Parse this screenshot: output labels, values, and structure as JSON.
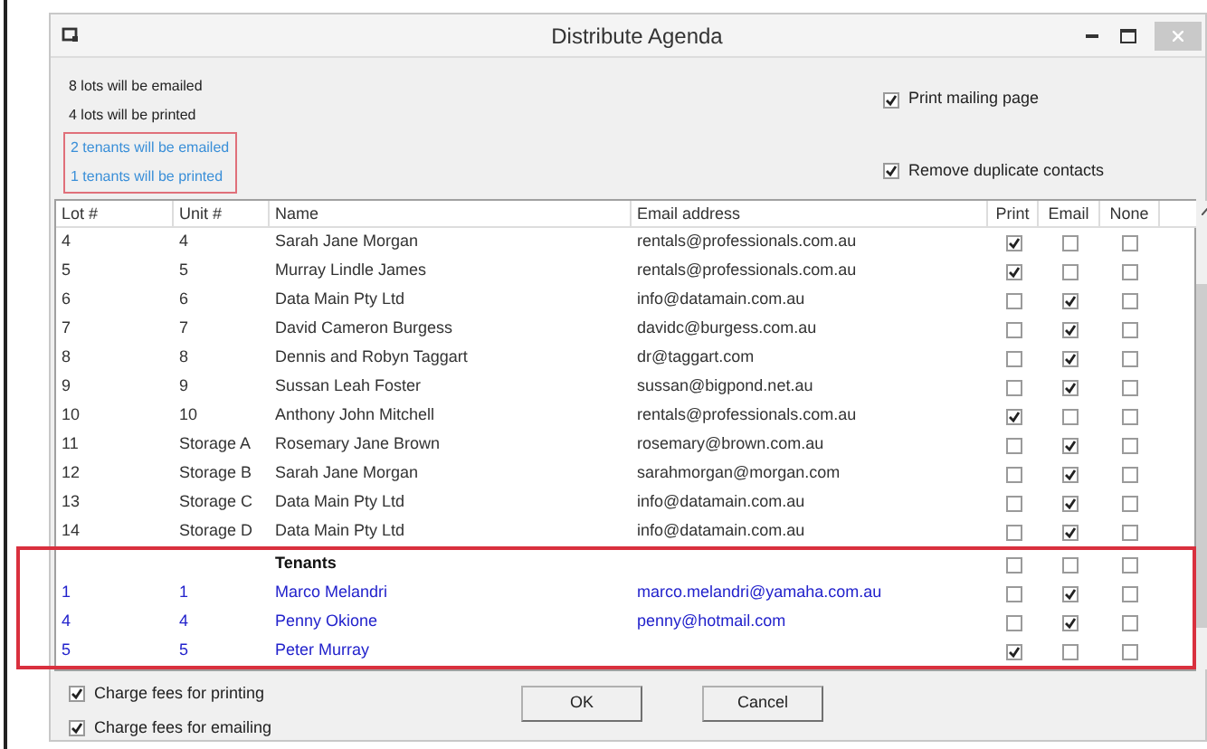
{
  "window": {
    "title": "Distribute Agenda"
  },
  "summary": [
    {
      "text": "8 lots will be emailed",
      "kind": "owner"
    },
    {
      "text": "4 lots will be printed",
      "kind": "owner"
    },
    {
      "text": "2 tenants will be emailed",
      "kind": "tenant"
    },
    {
      "text": "1 tenants will be printed",
      "kind": "tenant"
    }
  ],
  "options": [
    {
      "label": "Print mailing page",
      "checked": true
    },
    {
      "label": "Remove duplicate contacts",
      "checked": true
    }
  ],
  "table": {
    "columns": [
      "Lot #",
      "Unit #",
      "Name",
      "Email address",
      "Print",
      "Email",
      "None"
    ],
    "rows": [
      {
        "lot": "4",
        "unit": "4",
        "name": "Sarah Jane Morgan",
        "email": "rentals@professionals.com.au",
        "print": true,
        "mail": false,
        "none": false
      },
      {
        "lot": "5",
        "unit": "5",
        "name": "Murray Lindle James",
        "email": "rentals@professionals.com.au",
        "print": true,
        "mail": false,
        "none": false
      },
      {
        "lot": "6",
        "unit": "6",
        "name": "Data Main Pty Ltd",
        "email": "info@datamain.com.au",
        "print": false,
        "mail": true,
        "none": false
      },
      {
        "lot": "7",
        "unit": "7",
        "name": "David Cameron Burgess",
        "email": "davidc@burgess.com.au",
        "print": false,
        "mail": true,
        "none": false
      },
      {
        "lot": "8",
        "unit": "8",
        "name": "Dennis and Robyn Taggart",
        "email": "dr@taggart.com",
        "print": false,
        "mail": true,
        "none": false
      },
      {
        "lot": "9",
        "unit": "9",
        "name": "Sussan Leah Foster",
        "email": "sussan@bigpond.net.au",
        "print": false,
        "mail": true,
        "none": false
      },
      {
        "lot": "10",
        "unit": "10",
        "name": "Anthony John Mitchell",
        "email": "rentals@professionals.com.au",
        "print": true,
        "mail": false,
        "none": false
      },
      {
        "lot": "11",
        "unit": "Storage A",
        "name": "Rosemary Jane Brown",
        "email": "rosemary@brown.com.au",
        "print": false,
        "mail": true,
        "none": false
      },
      {
        "lot": "12",
        "unit": "Storage B",
        "name": "Sarah Jane Morgan",
        "email": "sarahmorgan@morgan.com",
        "print": false,
        "mail": true,
        "none": false
      },
      {
        "lot": "13",
        "unit": "Storage C",
        "name": "Data Main Pty Ltd",
        "email": "info@datamain.com.au",
        "print": false,
        "mail": true,
        "none": false
      },
      {
        "lot": "14",
        "unit": "Storage D",
        "name": "Data Main Pty Ltd",
        "email": "info@datamain.com.au",
        "print": false,
        "mail": true,
        "none": false
      }
    ],
    "tenant_heading": {
      "name": "Tenants",
      "print": false,
      "mail": false,
      "none": false
    },
    "tenant_rows": [
      {
        "lot": "1",
        "unit": "1",
        "name": "Marco Melandri",
        "email": "marco.melandri@yamaha.com.au",
        "print": false,
        "mail": true,
        "none": false
      },
      {
        "lot": "4",
        "unit": "4",
        "name": "Penny Okione",
        "email": "penny@hotmail.com",
        "print": false,
        "mail": true,
        "none": false
      },
      {
        "lot": "5",
        "unit": "5",
        "name": "Peter Murray",
        "print": true,
        "mail": false,
        "none": false
      }
    ]
  },
  "fees": [
    {
      "label": "Charge fees for printing",
      "checked": true
    },
    {
      "label": "Charge fees for emailing",
      "checked": true
    }
  ],
  "buttons": [
    "OK",
    "Cancel"
  ]
}
